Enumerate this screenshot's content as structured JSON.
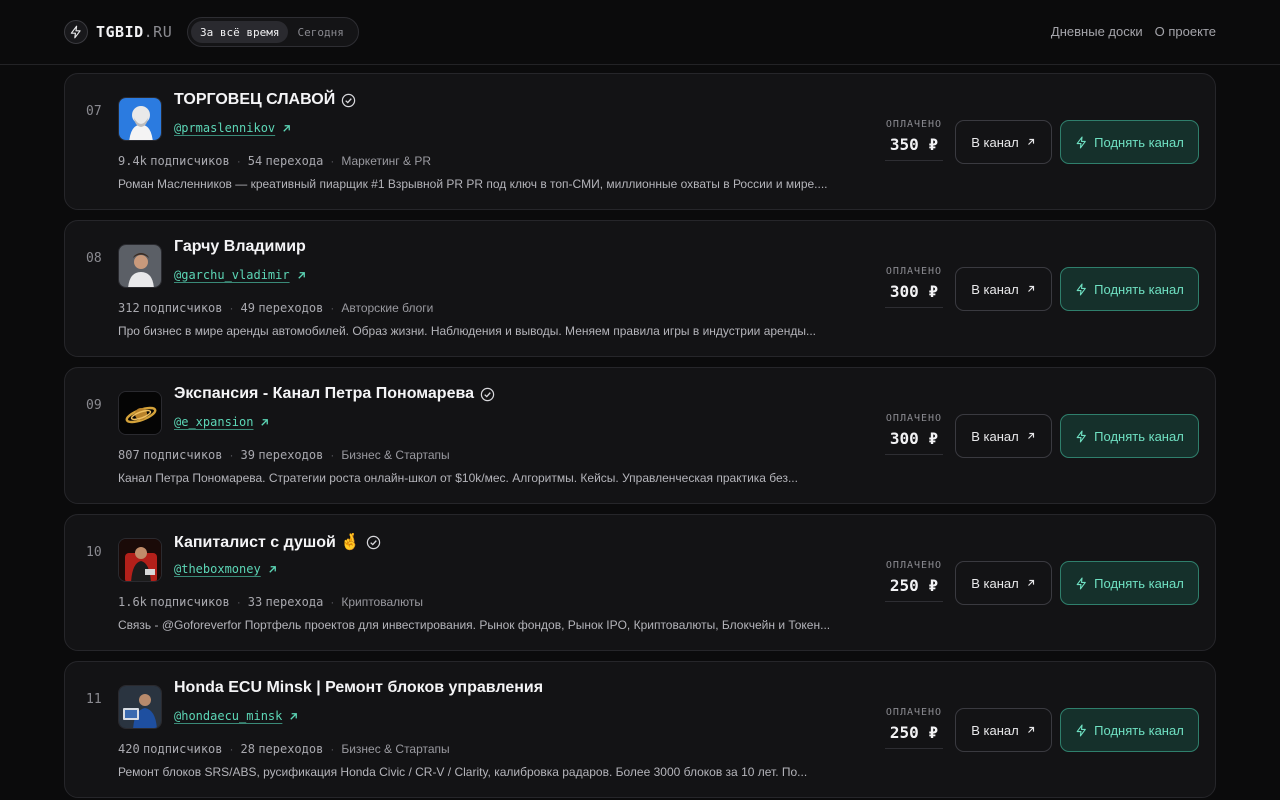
{
  "header": {
    "logo_main": "TGBID",
    "logo_suffix": ".RU",
    "period_all": "За всё время",
    "period_today": "Сегодня",
    "nav_daily": "Дневные доски",
    "nav_about": "О проекте"
  },
  "labels": {
    "paid": "ОПЛАЧЕНО",
    "to_channel": "В канал",
    "boost": "Поднять канал"
  },
  "colors": {
    "accent": "#5cd6b6",
    "boost_bg": "#15302b",
    "background": "#0b0b0c",
    "card": "#131315"
  },
  "channels": [
    {
      "rank": "07",
      "title": "ТОРГОВЕЦ СЛАВОЙ",
      "verified": true,
      "handle": "@prmaslennikov",
      "subscribers": "9.4k",
      "subscribers_label": "подписчиков",
      "clicks": "54",
      "clicks_label": "перехода",
      "category": "Маркетинг & PR",
      "description": "Роман Масленников — креативный пиарщик #1 Взрывной PR PR под ключ в топ-СМИ, миллионные охваты в России и мире....",
      "price": "350 ₽",
      "avatar_icon": "bearded-man-avatar"
    },
    {
      "rank": "08",
      "title": "Гарчу Владимир",
      "verified": false,
      "handle": "@garchu_vladimir",
      "subscribers": "312",
      "subscribers_label": "подписчиков",
      "clicks": "49",
      "clicks_label": "переходов",
      "category": "Авторские блоги",
      "description": "Про бизнес в мире аренды автомобилей. Образ жизни. Наблюдения и выводы. Меняем правила игры в индустрии аренды...",
      "price": "300 ₽",
      "avatar_icon": "man-portrait-avatar"
    },
    {
      "rank": "09",
      "title": "Экспансия - Канал Петра Пономарева",
      "verified": true,
      "handle": "@e_xpansion",
      "subscribers": "807",
      "subscribers_label": "подписчиков",
      "clicks": "39",
      "clicks_label": "переходов",
      "category": "Бизнес & Стартапы",
      "description": "Канал Петра Пономарева. Стратегии роста онлайн-школ от $10k/мес. Алгоритмы. Кейсы. Управленческая практика без...",
      "price": "300 ₽",
      "avatar_icon": "gold-planet-logo"
    },
    {
      "rank": "10",
      "title": "Капиталист с душой 🤞",
      "verified": true,
      "handle": "@theboxmoney",
      "subscribers": "1.6k",
      "subscribers_label": "подписчиков",
      "clicks": "33",
      "clicks_label": "перехода",
      "category": "Криптовалюты",
      "description": "Связь - @Goforeverfor Портфель проектов для инвестирования. Рынок фондов, Рынок IPO, Криптовалюты, Блокчейн и Токен...",
      "price": "250 ₽",
      "avatar_icon": "man-red-chair-avatar"
    },
    {
      "rank": "11",
      "title": "Honda ECU Minsk | Ремонт блоков управления",
      "verified": false,
      "handle": "@hondaecu_minsk",
      "subscribers": "420",
      "subscribers_label": "подписчиков",
      "clicks": "28",
      "clicks_label": "переходов",
      "category": "Бизнес & Стартапы",
      "description": "Ремонт блоков SRS/ABS, русификация Honda Civic / CR-V / Clarity, калибровка радаров. Более 3000 блоков за 10 лет. По...",
      "price": "250 ₽",
      "avatar_icon": "technician-avatar"
    }
  ]
}
